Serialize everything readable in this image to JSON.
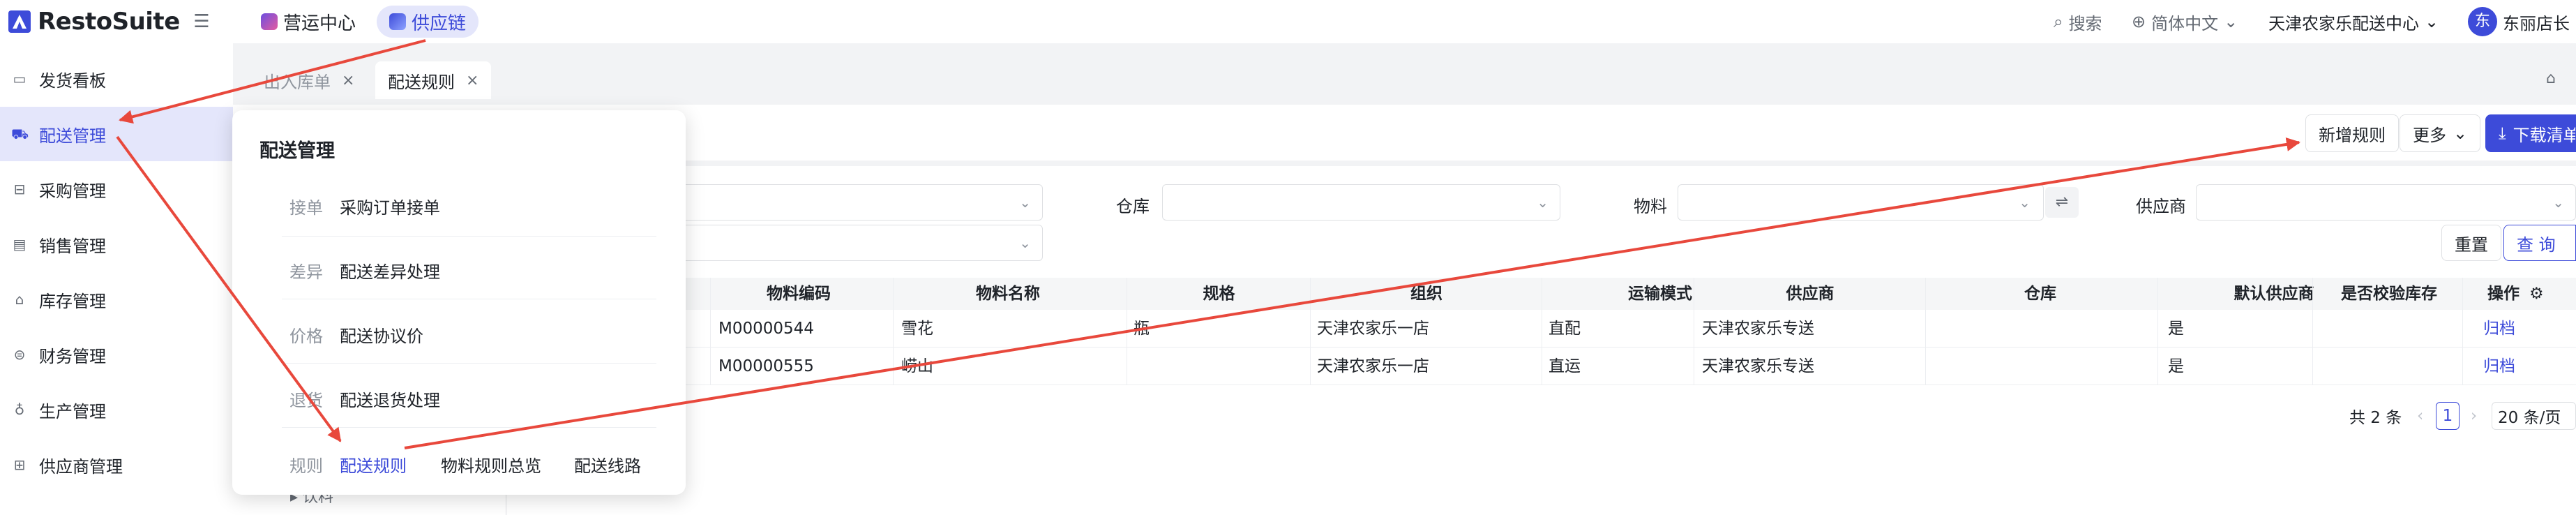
{
  "app": {
    "brand": "RestoSuite"
  },
  "topnav": {
    "ops_center": "营运中心",
    "supply_chain": "供应链"
  },
  "topright": {
    "search": "搜索",
    "language": "简体中文",
    "org": "天津农家乐配送中心",
    "avatar_char": "东",
    "user": "东丽店长"
  },
  "sidebar": {
    "items": [
      {
        "label": "发货看板",
        "icon": "monitor-icon"
      },
      {
        "label": "配送管理",
        "icon": "truck-icon"
      },
      {
        "label": "采购管理",
        "icon": "cart-icon"
      },
      {
        "label": "销售管理",
        "icon": "sale-icon"
      },
      {
        "label": "库存管理",
        "icon": "warehouse-icon"
      },
      {
        "label": "财务管理",
        "icon": "finance-icon"
      },
      {
        "label": "生产管理",
        "icon": "production-icon"
      },
      {
        "label": "供应商管理",
        "icon": "supplier-icon"
      }
    ]
  },
  "tabs": [
    {
      "label": "出入库单"
    },
    {
      "label": "配送规则"
    }
  ],
  "actions": {
    "add_rule": "新增规则",
    "more": "更多",
    "download": "下载清单"
  },
  "filters": {
    "warehouse": "仓库",
    "material": "物料",
    "supplier": "供应商",
    "reset": "重置",
    "query": "查 询"
  },
  "table": {
    "headers": [
      "物料编码",
      "物料名称",
      "规格",
      "组织",
      "运输模式",
      "供应商",
      "仓库",
      "默认供应商",
      "是否校验库存",
      "操作"
    ],
    "rows": [
      {
        "code": "M00000544",
        "name": "雪花",
        "spec": "瓶",
        "org": "天津农家乐一店",
        "mode": "直配",
        "supplier": "天津农家乐专送",
        "warehouse": "",
        "default_supplier": "是",
        "check_stock": "",
        "op": "归档"
      },
      {
        "code": "M00000555",
        "name": "崂山",
        "spec": "",
        "org": "天津农家乐一店",
        "mode": "直运",
        "supplier": "天津农家乐专送",
        "warehouse": "",
        "default_supplier": "是",
        "check_stock": "",
        "op": "归档"
      }
    ]
  },
  "pager": {
    "total": "共 2 条",
    "page": "1",
    "size": "20 条/页"
  },
  "popover": {
    "title": "配送管理",
    "groups": [
      {
        "cat": "接单",
        "links": [
          "采购订单接单"
        ]
      },
      {
        "cat": "差异",
        "links": [
          "配送差异处理"
        ]
      },
      {
        "cat": "价格",
        "links": [
          "配送协议价"
        ]
      },
      {
        "cat": "退货",
        "links": [
          "配送退货处理"
        ]
      },
      {
        "cat": "规则",
        "links": [
          "配送规则",
          "物料规则总览",
          "配送线路"
        ]
      }
    ]
  },
  "tree_fragment": "▸ 饮料",
  "colors": {
    "accent": "#3d4bd9",
    "annotation": "#e8483c"
  }
}
